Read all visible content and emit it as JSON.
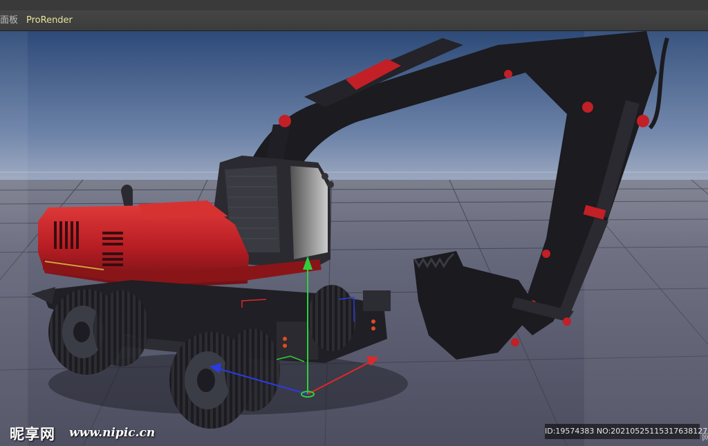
{
  "menu": {
    "items": [
      {
        "label": "面板"
      },
      {
        "label": "ProRender"
      }
    ]
  },
  "viewport": {
    "sky_color_top": "#2d4a78",
    "sky_color_horizon": "#9aa7bf",
    "ground_color": "#5f6072",
    "model_body_color": "#b81e24",
    "model_dark_color": "#1a1a1f",
    "gizmo": {
      "x_axis_color": "#e02828",
      "y_axis_color": "#2fd13a",
      "z_axis_color": "#2b3be0"
    }
  },
  "watermark": {
    "logo": "昵享网",
    "url": "www.nipic.cn",
    "id_text": "ID:19574383 NO:20210525115317638127"
  },
  "corner": {
    "label": "网"
  }
}
